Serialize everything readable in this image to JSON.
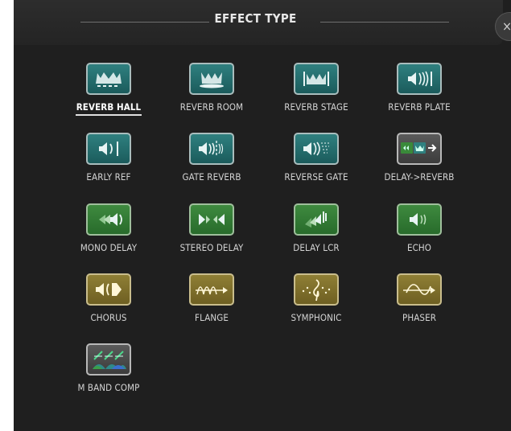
{
  "dialog": {
    "title": "EFFECT TYPE",
    "close_label": "×"
  },
  "effects": [
    {
      "label": "REVERB HALL",
      "icon": "reverb-hall-icon",
      "color": "teal",
      "selected": true
    },
    {
      "label": "REVERB ROOM",
      "icon": "reverb-room-icon",
      "color": "teal"
    },
    {
      "label": "REVERB STAGE",
      "icon": "reverb-stage-icon",
      "color": "teal"
    },
    {
      "label": "REVERB PLATE",
      "icon": "reverb-plate-icon",
      "color": "teal"
    },
    {
      "label": "EARLY REF",
      "icon": "early-ref-icon",
      "color": "teal"
    },
    {
      "label": "GATE REVERB",
      "icon": "gate-reverb-icon",
      "color": "teal"
    },
    {
      "label": "REVERSE GATE",
      "icon": "reverse-gate-icon",
      "color": "teal"
    },
    {
      "label": "DELAY->REVERB",
      "icon": "delay-reverb-icon",
      "color": "gray"
    },
    {
      "label": "MONO DELAY",
      "icon": "mono-delay-icon",
      "color": "green"
    },
    {
      "label": "STEREO DELAY",
      "icon": "stereo-delay-icon",
      "color": "green"
    },
    {
      "label": "DELAY LCR",
      "icon": "delay-lcr-icon",
      "color": "green"
    },
    {
      "label": "ECHO",
      "icon": "echo-icon",
      "color": "green"
    },
    {
      "label": "CHORUS",
      "icon": "chorus-icon",
      "color": "olive"
    },
    {
      "label": "FLANGE",
      "icon": "flange-icon",
      "color": "olive"
    },
    {
      "label": "SYMPHONIC",
      "icon": "symphonic-icon",
      "color": "olive"
    },
    {
      "label": "PHASER",
      "icon": "phaser-icon",
      "color": "olive"
    },
    {
      "label": "M BAND COMP",
      "icon": "m-band-comp-icon",
      "color": "gray"
    }
  ],
  "colors": {
    "teal": "#246c6c",
    "green": "#347c36",
    "olive": "#80702c",
    "gray": "#4a4a4a"
  }
}
